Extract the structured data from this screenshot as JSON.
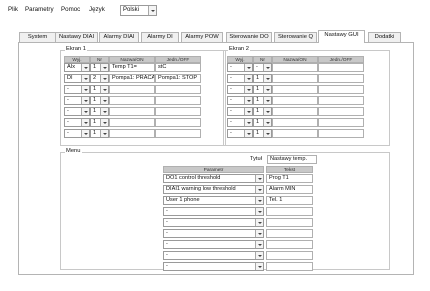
{
  "menu": [
    "Plik",
    "Parametry",
    "Pomoc",
    "Język"
  ],
  "language": "Polski",
  "tabs": [
    "System",
    "Nastawy DIAI",
    "Alarmy DIAI",
    "Alarmy DI",
    "Alarmy POW",
    "Sterowanie DO",
    "Sterowanie Q",
    "Nastawy GUI",
    "Dodatki"
  ],
  "active_tab": "Nastawy GUI",
  "screen1": {
    "label": "Ekran 1",
    "headers": [
      "Wyj.",
      "Nr",
      "Nazwa/ON",
      "Jedn./OFF"
    ],
    "rows": [
      {
        "wyj": "AIx",
        "nr": "1",
        "nazwa": "Temp T1=",
        "jedn": "stC"
      },
      {
        "wyj": "DI",
        "nr": "2",
        "nazwa": "Pompa1: PRACA",
        "jedn": "Pompa1: STOP"
      },
      {
        "wyj": "-",
        "nr": "1",
        "nazwa": "",
        "jedn": ""
      },
      {
        "wyj": "-",
        "nr": "1",
        "nazwa": "",
        "jedn": ""
      },
      {
        "wyj": "-",
        "nr": "1",
        "nazwa": "",
        "jedn": ""
      },
      {
        "wyj": "-",
        "nr": "1",
        "nazwa": "",
        "jedn": ""
      },
      {
        "wyj": "-",
        "nr": "1",
        "nazwa": "",
        "jedn": ""
      }
    ]
  },
  "screen2": {
    "label": "Ekran 2",
    "headers": [
      "Wyj.",
      "Nr",
      "Nazwa/ON",
      "Jedn./OFF"
    ],
    "rows": [
      {
        "wyj": "-",
        "nr": "-",
        "nazwa": "",
        "jedn": ""
      },
      {
        "wyj": "-",
        "nr": "1",
        "nazwa": "",
        "jedn": ""
      },
      {
        "wyj": "-",
        "nr": "1",
        "nazwa": "",
        "jedn": ""
      },
      {
        "wyj": "-",
        "nr": "1",
        "nazwa": "",
        "jedn": ""
      },
      {
        "wyj": "-",
        "nr": "1",
        "nazwa": "",
        "jedn": ""
      },
      {
        "wyj": "-",
        "nr": "1",
        "nazwa": "",
        "jedn": ""
      },
      {
        "wyj": "-",
        "nr": "1",
        "nazwa": "",
        "jedn": ""
      }
    ]
  },
  "menu_group": {
    "label": "Menu",
    "title_label": "Tytuł",
    "title_value": "Nastawy temp.",
    "headers": [
      "Parametr",
      "Tekst"
    ],
    "rows": [
      {
        "param": "DO1 control threshold",
        "text": "Prog T1"
      },
      {
        "param": "DIAI1 warning low threshold",
        "text": "Alarm MIN"
      },
      {
        "param": "User 1 phone",
        "text": "Tel. 1"
      },
      {
        "param": "-",
        "text": ""
      },
      {
        "param": "-",
        "text": ""
      },
      {
        "param": "-",
        "text": ""
      },
      {
        "param": "-",
        "text": ""
      },
      {
        "param": "-",
        "text": ""
      },
      {
        "param": "-",
        "text": ""
      }
    ]
  }
}
